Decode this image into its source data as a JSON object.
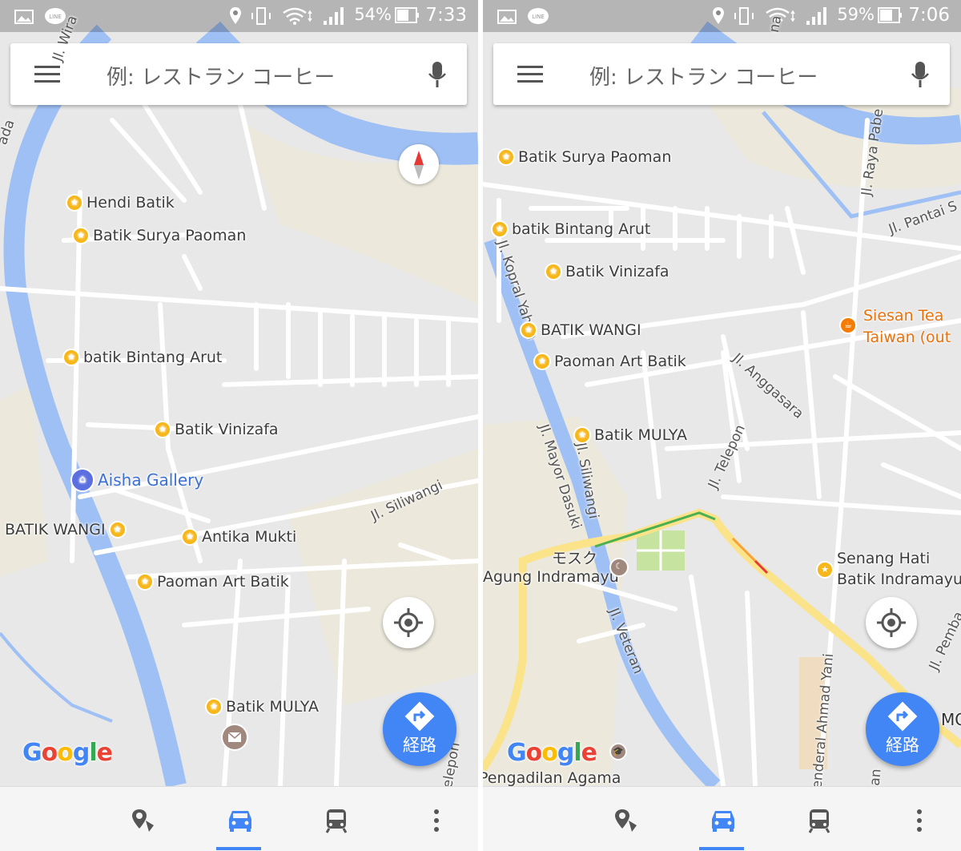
{
  "left": {
    "status": {
      "battery": "54%",
      "time": "7:33"
    },
    "search": {
      "placeholder": "例: レストラン コーヒー"
    },
    "pois": [
      {
        "name": "Hendi Batik"
      },
      {
        "name": "Batik Surya Paoman"
      },
      {
        "name": "batik Bintang Arut"
      },
      {
        "name": "Batik Vinizafa"
      },
      {
        "name": "Aisha Gallery"
      },
      {
        "name": "BATIK WANGI"
      },
      {
        "name": "Antika Mukti"
      },
      {
        "name": "Paoman Art Batik"
      },
      {
        "name": "Batik MULYA"
      }
    ],
    "roads": {
      "siliwangi": "Jl. Siliwangi",
      "top": "Jl. Wira",
      "edge_left": "ada",
      "edge_right": "elepon"
    },
    "route_label": "経路",
    "google": [
      "G",
      "o",
      "o",
      "g",
      "l",
      "e"
    ]
  },
  "right": {
    "status": {
      "battery": "59%",
      "time": "7:06"
    },
    "search": {
      "placeholder": "例: レストラン コーヒー"
    },
    "pois": [
      {
        "name": "Batik Surya Paoman"
      },
      {
        "name": "batik Bintang Arut"
      },
      {
        "name": "Batik Vinizafa"
      },
      {
        "name": "BATIK WANGI"
      },
      {
        "name": "Paoman Art Batik"
      },
      {
        "name": "Batik MULYA"
      },
      {
        "name": "Siesan Tea",
        "line2": "Taiwan (out"
      },
      {
        "name": "モスク",
        "line2": "Agung Indramayu"
      },
      {
        "name": "Senang Hati",
        "line2": "Batik Indramayu"
      },
      {
        "name": "Pengadilan Agama"
      }
    ],
    "roads": {
      "raya_pabean": "Jl. Raya Pabe",
      "pantai": "Jl. Pantai S",
      "kopral": "Jl. Kopral Yahya",
      "anggasara": "Jl. Anggasara",
      "telepon": "Jl. Telepon",
      "mayor": "Jl. Mayor Dasuki",
      "siliwangi": "Jl. Siliwangi",
      "veteran": "Jl. Veteran",
      "ahmad_yani": "enderal Ahmad Yani",
      "pemba": "Jl. Pemba",
      "top": "na",
      "mo": "MO",
      "an": "an"
    },
    "route_label": "経路",
    "google": [
      "G",
      "o",
      "o",
      "g",
      "l",
      "e"
    ]
  },
  "colors": {
    "accent": "#4285f4",
    "poi": "#f7b71a",
    "water": "#9fc0f5",
    "park": "#c7e3a0"
  },
  "icons": [
    "gallery-icon",
    "line-icon",
    "location-pin-icon",
    "vibrate-icon",
    "wifi-icon",
    "signal-icon",
    "battery-icon",
    "menu-icon",
    "mic-icon",
    "compass-icon",
    "my-location-icon",
    "directions-icon",
    "explore-icon",
    "car-icon",
    "transit-icon",
    "more-icon"
  ]
}
